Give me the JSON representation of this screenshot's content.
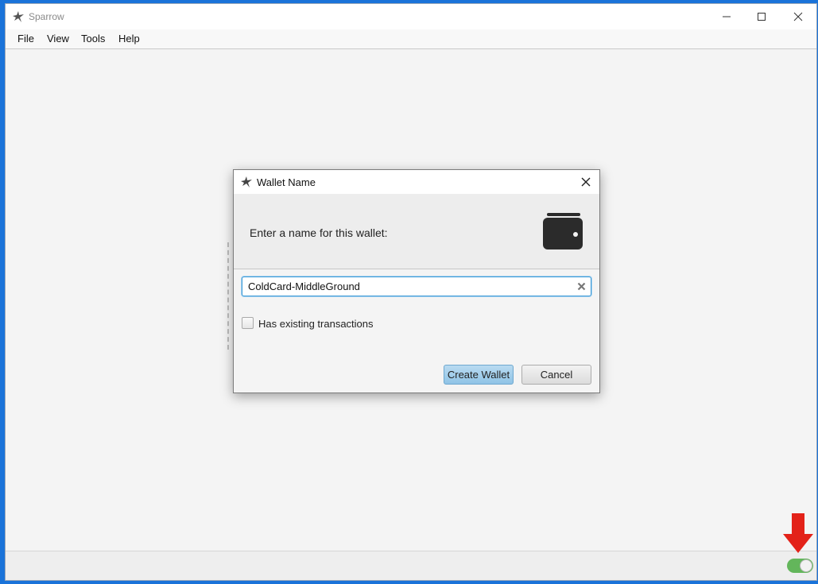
{
  "app": {
    "title": "Sparrow"
  },
  "menu": {
    "items": [
      {
        "label": "File"
      },
      {
        "label": "View"
      },
      {
        "label": "Tools"
      },
      {
        "label": "Help"
      }
    ]
  },
  "dialog": {
    "title": "Wallet Name",
    "prompt": "Enter a name for this wallet:",
    "name_field": {
      "value": "ColdCard-MiddleGround"
    },
    "checkbox": {
      "label": "Has existing transactions",
      "checked": false
    },
    "buttons": {
      "create": "Create Wallet",
      "cancel": "Cancel"
    }
  },
  "status_toggle": {
    "on": true,
    "color": "#63b65b"
  },
  "accent": {
    "arrow": "#e32219",
    "focus": "#3b99d6",
    "desktop": "#1a73d9"
  },
  "icons": [
    "sparrow-logo-icon",
    "minimize-icon",
    "maximize-icon",
    "close-icon",
    "wallet-icon",
    "clear-icon",
    "down-arrow-icon"
  ]
}
